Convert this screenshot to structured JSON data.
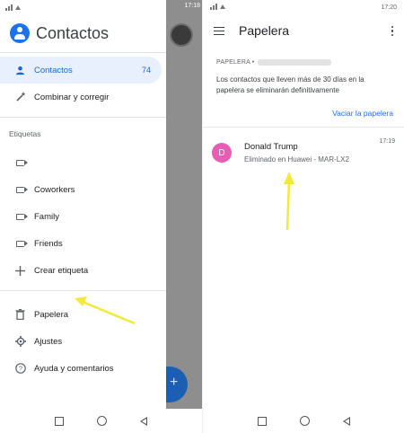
{
  "left_screen": {
    "status": {
      "time": "17:18"
    },
    "drawer": {
      "app_title": "Contactos",
      "nav_primary": [
        {
          "label": "Contactos",
          "count": "74",
          "icon": "person-icon"
        },
        {
          "label": "Combinar y corregir",
          "icon": "magic-wand-icon"
        }
      ],
      "section_label": "Etiquetas",
      "labels": [
        {
          "label": ""
        },
        {
          "label": "Coworkers"
        },
        {
          "label": "Family"
        },
        {
          "label": "Friends"
        }
      ],
      "create_label": "Crear etiqueta",
      "nav_bottom": [
        {
          "label": "Papelera",
          "icon": "trash-icon"
        },
        {
          "label": "Ajustes",
          "icon": "gear-icon"
        },
        {
          "label": "Ayuda y comentarios",
          "icon": "help-icon"
        }
      ]
    }
  },
  "right_screen": {
    "status": {
      "time": "17:20"
    },
    "appbar": {
      "title": "Papelera"
    },
    "info": {
      "heading": "PAPELERA •",
      "notice": "Los contactos que lleven más de 30 días en la papelera se eliminarán definitivamente",
      "empty_button": "Vaciar la papelera"
    },
    "contact": {
      "initial": "D",
      "name": "Donald Trump",
      "subtitle": "Eliminado en Huawei - MAR-LX2",
      "time": "17:19",
      "avatar_color": "#e75cb5"
    }
  },
  "colors": {
    "accent": "#1a73e8",
    "active_bg": "#e8f0fe",
    "arrow": "#f2e93a"
  }
}
